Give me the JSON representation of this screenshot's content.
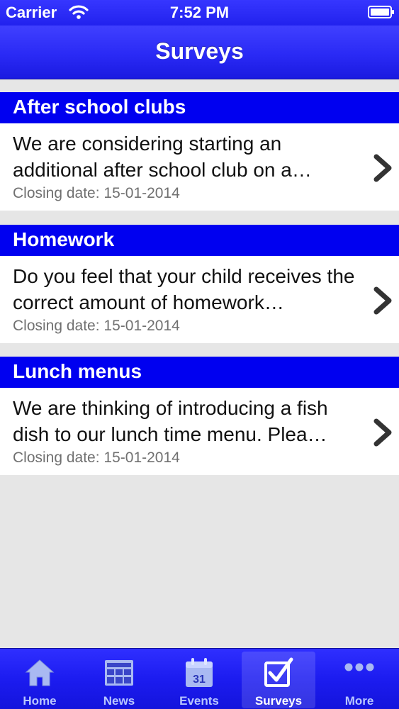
{
  "status_bar": {
    "carrier": "Carrier",
    "time": "7:52 PM"
  },
  "nav": {
    "title": "Surveys"
  },
  "surveys": [
    {
      "title": "After school clubs",
      "description": "We are considering starting an additional after school club on a…",
      "closing": "Closing date: 15-01-2014"
    },
    {
      "title": "Homework",
      "description": "Do you feel that your child receives the correct amount of homework…",
      "closing": "Closing date: 15-01-2014"
    },
    {
      "title": "Lunch menus",
      "description": "We are thinking of introducing a fish dish to our lunch time menu.  Plea…",
      "closing": "Closing date: 15-01-2014"
    }
  ],
  "tabs": [
    {
      "label": "Home",
      "icon": "home-icon"
    },
    {
      "label": "News",
      "icon": "news-icon"
    },
    {
      "label": "Events",
      "icon": "calendar-icon",
      "icon_text": "31"
    },
    {
      "label": "Surveys",
      "icon": "checkbox-icon",
      "active": true
    },
    {
      "label": "More",
      "icon": "more-icon"
    }
  ],
  "colors": {
    "accent": "#0000f0",
    "background": "#e6e6e6",
    "muted_text": "#707070"
  }
}
